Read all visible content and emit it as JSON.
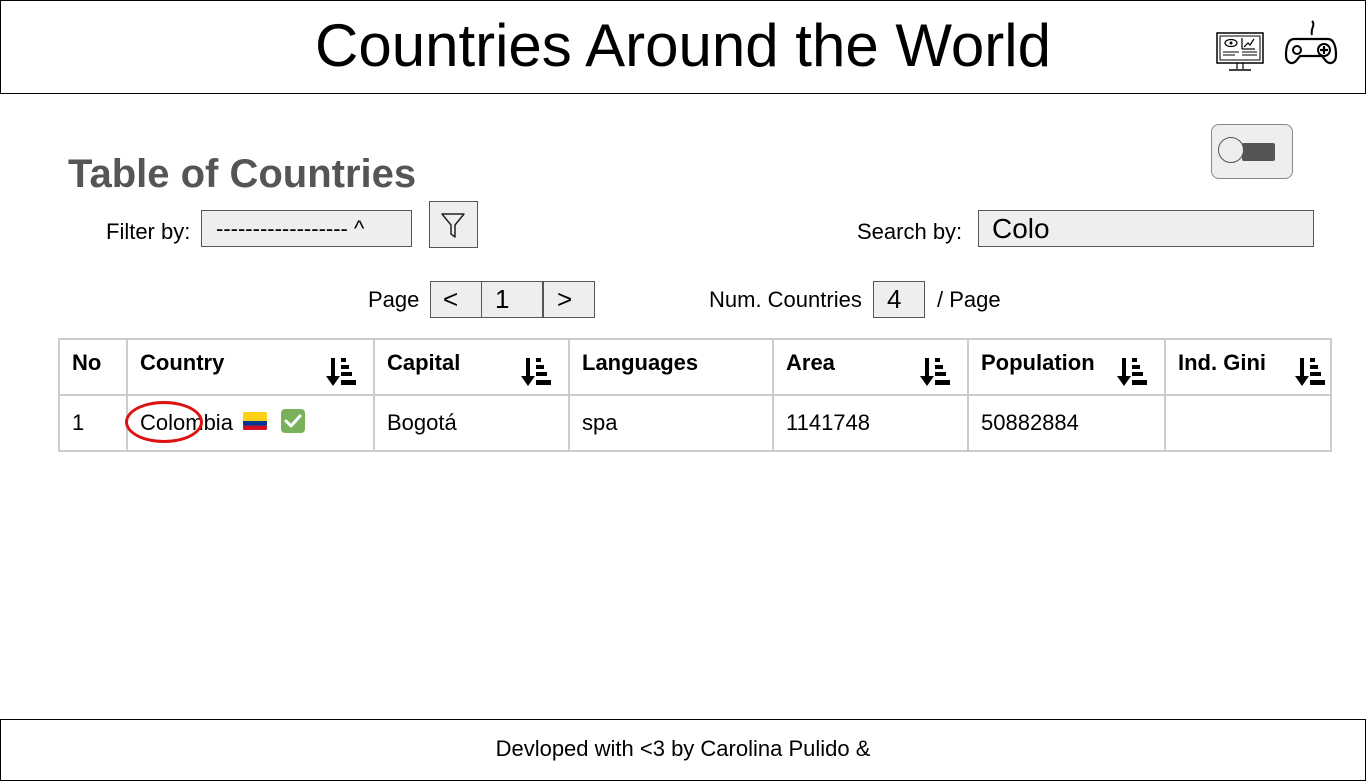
{
  "header": {
    "title": "Countries Around the World",
    "icons": [
      "monitor-dashboard-icon",
      "gamepad-icon"
    ]
  },
  "toggle": {
    "state": "off"
  },
  "section": {
    "title": "Table of Countries"
  },
  "filter": {
    "label": "Filter by:",
    "selected": "------------------ ^",
    "button_icon": "filter-icon"
  },
  "search": {
    "label": "Search by:",
    "value": "Colo"
  },
  "pagination": {
    "page_label": "Page",
    "prev": "<",
    "page": "1",
    "next": ">",
    "num_label": "Num. Countries",
    "per_page": "4",
    "per_label": "/ Page"
  },
  "table": {
    "columns": [
      {
        "label": "No",
        "sortable": false
      },
      {
        "label": "Country",
        "sortable": true
      },
      {
        "label": "Capital",
        "sortable": true
      },
      {
        "label": "Languages",
        "sortable": false
      },
      {
        "label": "Area",
        "sortable": true
      },
      {
        "label": "Population",
        "sortable": true
      },
      {
        "label": "Ind. Gini",
        "sortable": true
      }
    ],
    "rows": [
      {
        "no": "1",
        "country": "Colombia",
        "flag_colors": [
          "#FCD116",
          "#003893",
          "#CE1126"
        ],
        "verified_icon": "check-box-icon",
        "capital": "Bogotá",
        "languages": "spa",
        "area": "1141748",
        "population": "50882884",
        "gini": ""
      }
    ]
  },
  "footer": {
    "text": "Devloped with <3 by Carolina Pulido &"
  },
  "colors": {
    "highlight": "#dd1111",
    "check": "#78b159",
    "control_bg": "#eeeeee",
    "title_gray": "#555555"
  }
}
